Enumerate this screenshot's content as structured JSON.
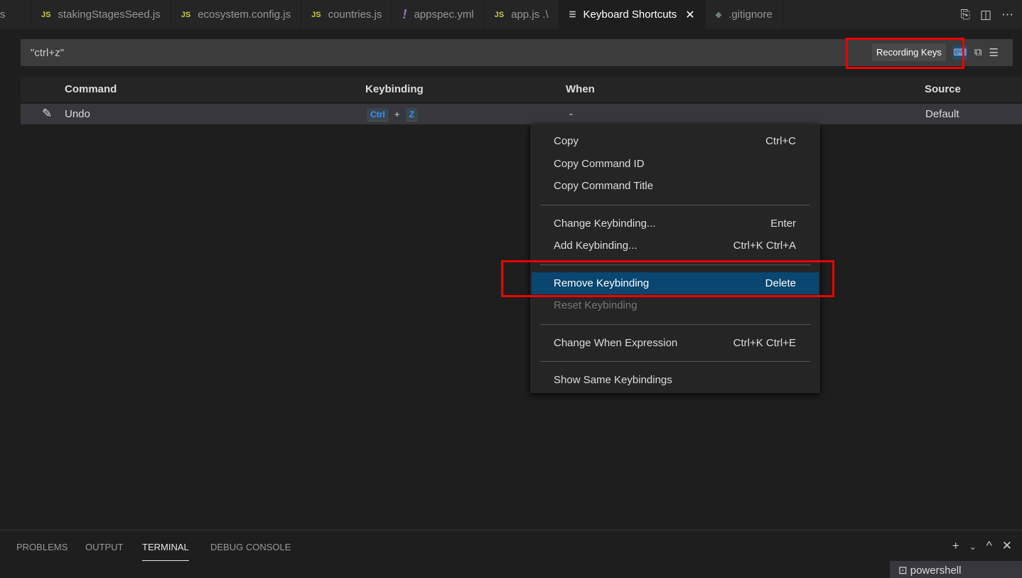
{
  "tabs": [
    {
      "label": "s",
      "icon": "js",
      "active": false
    },
    {
      "label": "stakingStagesSeed.js",
      "icon": "js"
    },
    {
      "label": "ecosystem.config.js",
      "icon": "js"
    },
    {
      "label": "countries.js",
      "icon": "js"
    },
    {
      "label": "appspec.yml",
      "icon": "yml"
    },
    {
      "label": "app.js .\\",
      "icon": "js"
    },
    {
      "label": "Keyboard Shortcuts",
      "icon": "keyboard",
      "active": true
    },
    {
      "label": ".gitignore",
      "icon": "git"
    }
  ],
  "icons": {
    "js": "JS",
    "yml": "!",
    "git": "◆",
    "keyboard": "☰"
  },
  "search": {
    "value": "\"ctrl+z\"",
    "recording_label": "Recording Keys"
  },
  "table": {
    "headers": [
      "Command",
      "Keybinding",
      "When",
      "Source"
    ],
    "row": {
      "command": "Undo",
      "keys": [
        "Ctrl",
        "Z"
      ],
      "plus": "+",
      "when": "-",
      "source": "Default"
    }
  },
  "menu": {
    "groups": [
      [
        {
          "label": "Copy",
          "shortcut": "Ctrl+C"
        },
        {
          "label": "Copy Command ID",
          "shortcut": ""
        },
        {
          "label": "Copy Command Title",
          "shortcut": ""
        }
      ],
      [
        {
          "label": "Change Keybinding...",
          "shortcut": "Enter"
        },
        {
          "label": "Add Keybinding...",
          "shortcut": "Ctrl+K Ctrl+A"
        }
      ],
      [
        {
          "label": "Remove Keybinding",
          "shortcut": "Delete",
          "selected": true
        },
        {
          "label": "Reset Keybinding",
          "shortcut": "",
          "disabled": true
        }
      ],
      [
        {
          "label": "Change When Expression",
          "shortcut": "Ctrl+K Ctrl+E"
        }
      ],
      [
        {
          "label": "Show Same Keybindings",
          "shortcut": ""
        }
      ]
    ]
  },
  "panel": {
    "tabs": [
      "PROBLEMS",
      "OUTPUT",
      "TERMINAL",
      "DEBUG CONSOLE"
    ],
    "active": "TERMINAL",
    "terminal": "powershell"
  },
  "colors": {
    "highlight": "#094771",
    "annotation": "#ee0000",
    "key_text": "#3794ff"
  }
}
